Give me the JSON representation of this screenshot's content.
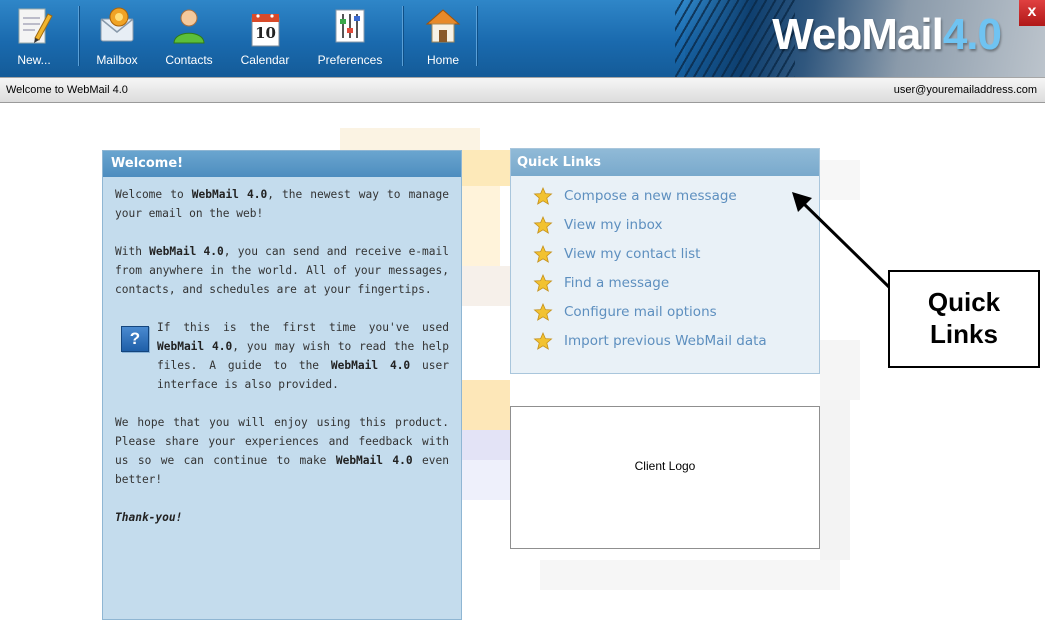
{
  "toolbar": {
    "buttons": [
      {
        "label": "New...",
        "icon": "new-message-icon"
      },
      {
        "label": "Mailbox",
        "icon": "mailbox-icon"
      },
      {
        "label": "Contacts",
        "icon": "contacts-icon"
      },
      {
        "label": "Calendar",
        "icon": "calendar-icon",
        "calendar_day": "10"
      },
      {
        "label": "Preferences",
        "icon": "preferences-icon"
      },
      {
        "label": "Home",
        "icon": "home-icon"
      }
    ],
    "brand_main": "WebMail",
    "brand_version": "4.0",
    "close_glyph": "x"
  },
  "status_bar": {
    "welcome_text": "Welcome to WebMail 4.0",
    "user_email": "user@youremailaddress.com"
  },
  "welcome_panel": {
    "title": "Welcome!",
    "p1_pre": "Welcome to ",
    "p1_bold": "WebMail 4.0",
    "p1_post": ", the newest way to manage your email on the web!",
    "p2_pre": "With ",
    "p2_bold": "WebMail 4.0",
    "p2_post": ", you can send and receive e-mail from anywhere in the world. All of your messages, contacts, and schedules are at your fingertips.",
    "p3_pre": "If this is the first time you've used ",
    "p3_bold1": "WebMail 4.0",
    "p3_mid": ", you may wish to read the help files. A guide to the ",
    "p3_bold2": "WebMail 4.0",
    "p3_post": " user interface is also provided.",
    "help_glyph": "?",
    "p4_pre": "We hope that you will enjoy using this product. Please share your experiences and feedback with us so we can continue to make ",
    "p4_bold": "WebMail 4.0",
    "p4_post": " even better!",
    "signoff": "Thank-you!"
  },
  "quick_links": {
    "title": "Quick Links",
    "items": [
      "Compose a new message",
      "View my inbox",
      "View my contact list",
      "Find a message",
      "Configure mail options",
      "Import previous WebMail data"
    ]
  },
  "client_logo": {
    "text": "Client Logo"
  },
  "annotation": {
    "line1": "Quick",
    "line2": "Links"
  },
  "colors": {
    "toolbar_blue": "#1a6aae",
    "link_blue": "#5d8fbf",
    "panel_blue": "#c4dced",
    "star_yellow": "#f2c230"
  }
}
